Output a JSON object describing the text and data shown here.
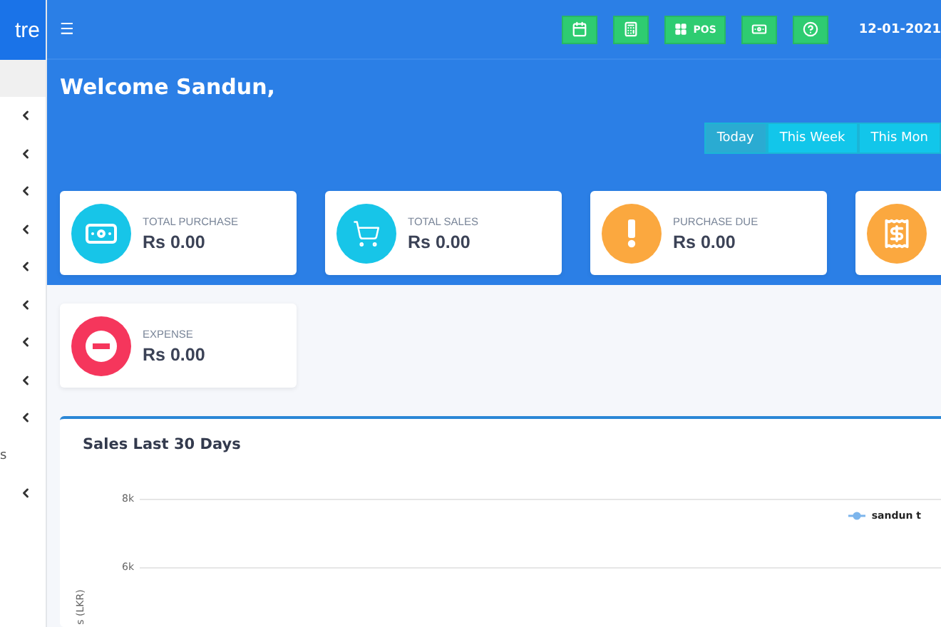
{
  "brand": {
    "text": "tre"
  },
  "sidebar": {
    "items": [
      {
        "kind": "submenu"
      },
      {
        "kind": "submenu"
      },
      {
        "kind": "submenu"
      },
      {
        "kind": "submenu"
      },
      {
        "kind": "submenu"
      },
      {
        "kind": "submenu"
      },
      {
        "kind": "submenu"
      },
      {
        "kind": "submenu"
      },
      {
        "kind": "submenu"
      },
      {
        "kind": "text",
        "label": "s"
      },
      {
        "kind": "submenu"
      }
    ]
  },
  "topbar": {
    "menu": "☰",
    "buttons": [
      {
        "kind": "calendar"
      },
      {
        "kind": "calculator"
      },
      {
        "kind": "pos",
        "label": "POS"
      },
      {
        "kind": "cash"
      },
      {
        "kind": "help"
      }
    ],
    "date": "12-01-2021"
  },
  "welcome": "Welcome Sandun,",
  "tabs": [
    {
      "label": "Today",
      "selected": true
    },
    {
      "label": "This Week",
      "selected": false
    },
    {
      "label": "This Mon",
      "selected": false
    }
  ],
  "cards": [
    {
      "kind": "purchase",
      "color": "#17c5e8",
      "label": "TOTAL PURCHASE",
      "value": "Rs 0.00"
    },
    {
      "kind": "sales",
      "color": "#17c5e8",
      "label": "TOTAL SALES",
      "value": "Rs 0.00"
    },
    {
      "kind": "due",
      "color": "#fba83f",
      "label": "PURCHASE DUE",
      "value": "Rs 0.00"
    },
    {
      "kind": "invoice",
      "color": "#fba83f"
    },
    {
      "kind": "expense",
      "color": "#f5365c",
      "label": "EXPENSE",
      "value": "Rs 0.00"
    }
  ],
  "chart": {
    "title": "Sales Last 30 Days",
    "yticks": [
      "8k",
      "6k"
    ],
    "ylabel": "s (LKR)",
    "legend": "sandun t"
  }
}
